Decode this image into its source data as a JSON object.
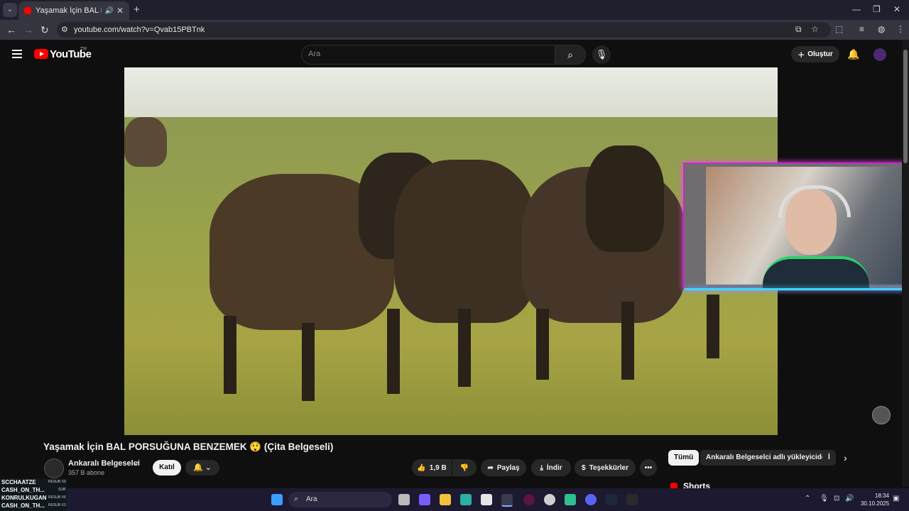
{
  "browser": {
    "tab_title": "Yaşamak İçin BAL PORSUĞU",
    "url": "youtube.com/watch?v=Qvab15PBTnk",
    "new_tab": "+",
    "menu": "⌄",
    "minimize": "—",
    "restore": "❐",
    "close": "✕"
  },
  "youtube": {
    "logo_text": "YouTube",
    "country_code": "TR",
    "search_placeholder": "Ara",
    "create_label": "Oluştur"
  },
  "video": {
    "title": "Yaşamak İçin BAL PORSUĞUNA BENZEMEK 😲 (Çita Belgeseli)",
    "channel_name": "Ankaralı Belgeselci",
    "subscribers": "357 B abone",
    "join_label": "Katıl",
    "like_count": "1,9 B",
    "share_label": "Paylaş",
    "download_label": "İndir",
    "thanks_label": "Teşekkürler",
    "more_label": "•••"
  },
  "chips": [
    "Tümü",
    "Ankaralı Belgeselci adlı yükleyiciden",
    "İ"
  ],
  "shorts_label": "Shorts",
  "chat": [
    {
      "name": "SCCHAATZE",
      "badge": "RESUB X9"
    },
    {
      "name": "CASH_ON_TH...",
      "badge": "SUB"
    },
    {
      "name": "KONRULKUGAN",
      "badge": "RESUB X6"
    },
    {
      "name": "CASH_ON_TH...",
      "badge": "RESUB X3"
    }
  ],
  "taskbar": {
    "search_label": "Ara",
    "time": "18:34",
    "date": "30.10.2025"
  },
  "colors": {
    "yt_red": "#ff0000",
    "webcam_border": "#c030c0",
    "webcam_glow": "#3bd8ff"
  }
}
